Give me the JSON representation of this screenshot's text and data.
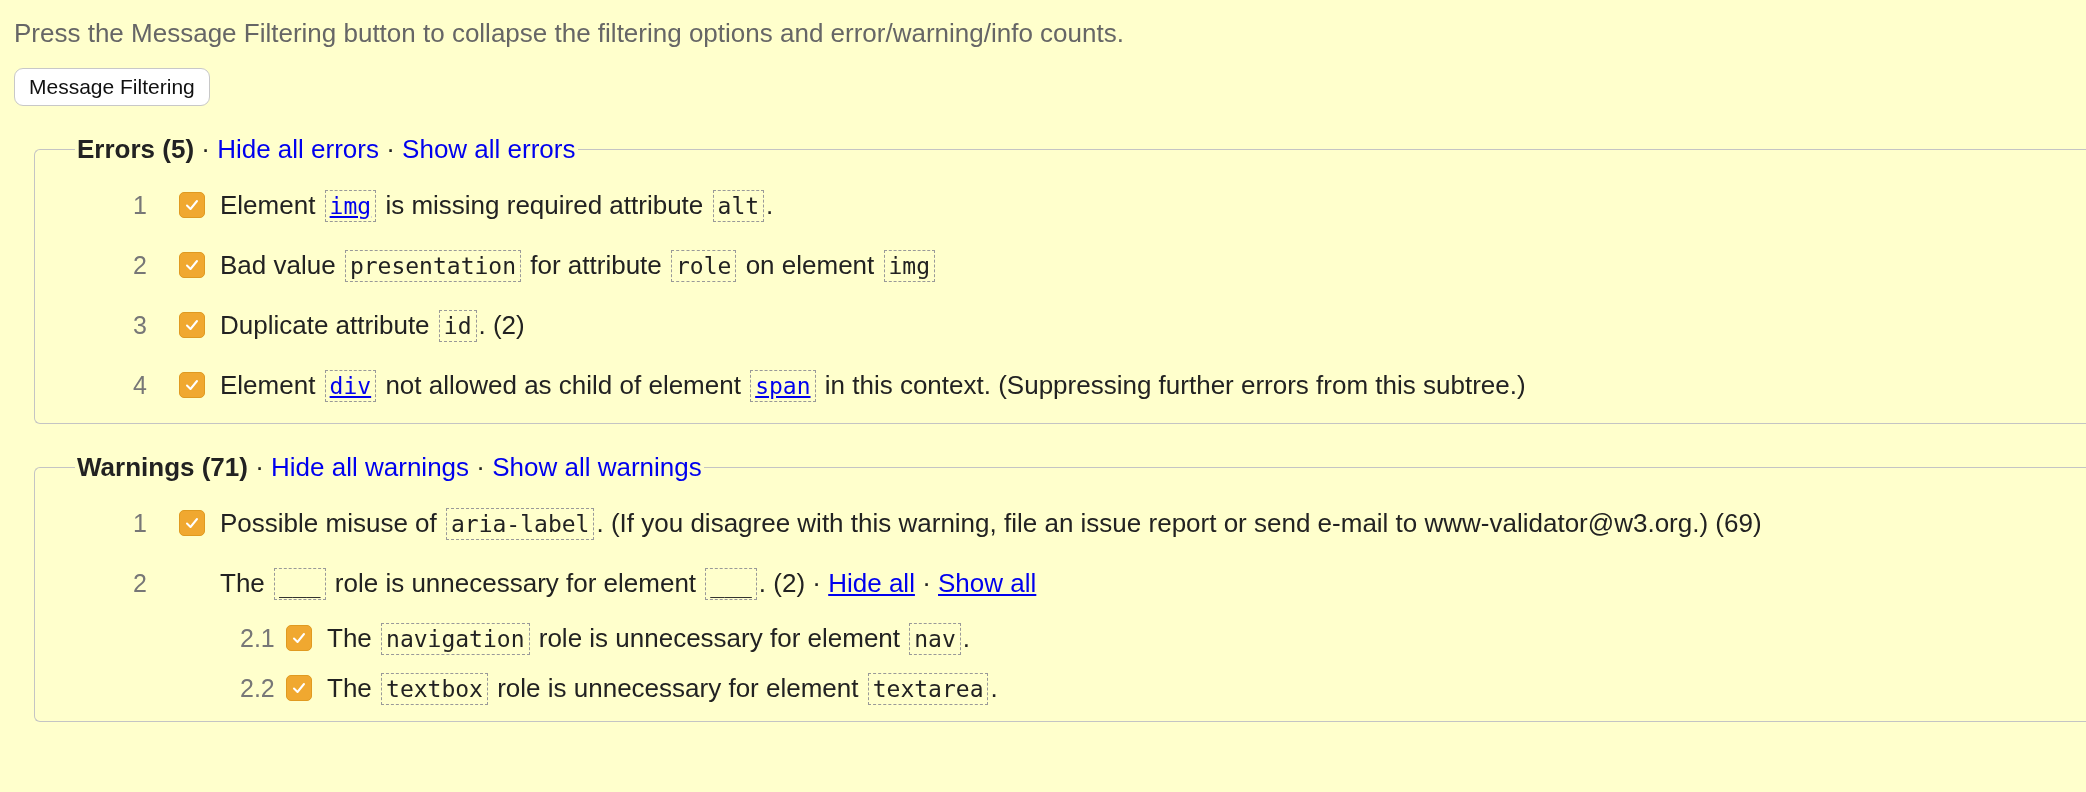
{
  "intro": "Press the Message Filtering button to collapse the filtering options and error/warning/info counts.",
  "filter_button": "Message Filtering",
  "sections": [
    {
      "title": "Errors (5)",
      "separator": "·",
      "hide_link": "Hide all errors",
      "show_link": "Show all errors",
      "items": [
        {
          "kind": "message",
          "number": "1",
          "checked": true,
          "parts": [
            {
              "kind": "text",
              "text": "Element "
            },
            {
              "kind": "code",
              "text": "img",
              "link": true
            },
            {
              "kind": "text",
              "text": " is missing required attribute "
            },
            {
              "kind": "code",
              "text": "alt",
              "link": false
            },
            {
              "kind": "text",
              "text": "."
            }
          ]
        },
        {
          "kind": "message",
          "number": "2",
          "checked": true,
          "parts": [
            {
              "kind": "text",
              "text": "Bad value "
            },
            {
              "kind": "code",
              "text": "presentation",
              "link": false
            },
            {
              "kind": "text",
              "text": " for attribute "
            },
            {
              "kind": "code",
              "text": "role",
              "link": false
            },
            {
              "kind": "text",
              "text": " on element "
            },
            {
              "kind": "code",
              "text": "img",
              "link": false
            }
          ]
        },
        {
          "kind": "message",
          "number": "3",
          "checked": true,
          "parts": [
            {
              "kind": "text",
              "text": "Duplicate attribute "
            },
            {
              "kind": "code",
              "text": "id",
              "link": false
            },
            {
              "kind": "text",
              "text": ". (2)"
            }
          ]
        },
        {
          "kind": "message",
          "number": "4",
          "checked": true,
          "parts": [
            {
              "kind": "text",
              "text": "Element "
            },
            {
              "kind": "code",
              "text": "div",
              "link": true
            },
            {
              "kind": "text",
              "text": " not allowed as child of element "
            },
            {
              "kind": "code",
              "text": "span",
              "link": true
            },
            {
              "kind": "text",
              "text": " in this context. (Suppressing further errors from this subtree.)"
            }
          ]
        }
      ]
    },
    {
      "title": "Warnings (71)",
      "separator": "·",
      "hide_link": "Hide all warnings",
      "show_link": "Show all warnings",
      "items": [
        {
          "kind": "message",
          "number": "1",
          "checked": true,
          "parts": [
            {
              "kind": "text",
              "text": "Possible misuse of "
            },
            {
              "kind": "code",
              "text": "aria-label",
              "link": false
            },
            {
              "kind": "text",
              "text": ". (If you disagree with this warning, file an issue report or send e-mail to www-validator@w3.org.) (69)"
            }
          ]
        },
        {
          "kind": "group",
          "number": "2",
          "parts": [
            {
              "kind": "text",
              "text": "The "
            },
            {
              "kind": "code",
              "text": "___",
              "link": false
            },
            {
              "kind": "text",
              "text": " role is unnecessary for element "
            },
            {
              "kind": "code",
              "text": "___",
              "link": false
            },
            {
              "kind": "text",
              "text": ". (2) · "
            },
            {
              "kind": "link",
              "text": "Hide all"
            },
            {
              "kind": "text",
              "text": " · "
            },
            {
              "kind": "link",
              "text": "Show all"
            }
          ],
          "children": [
            {
              "kind": "message",
              "number": "2.1",
              "checked": true,
              "parts": [
                {
                  "kind": "text",
                  "text": "The "
                },
                {
                  "kind": "code",
                  "text": "navigation",
                  "link": false
                },
                {
                  "kind": "text",
                  "text": " role is unnecessary for element "
                },
                {
                  "kind": "code",
                  "text": "nav",
                  "link": false
                },
                {
                  "kind": "text",
                  "text": "."
                }
              ]
            },
            {
              "kind": "message",
              "number": "2.2",
              "checked": true,
              "parts": [
                {
                  "kind": "text",
                  "text": "The "
                },
                {
                  "kind": "code",
                  "text": "textbox",
                  "link": false
                },
                {
                  "kind": "text",
                  "text": " role is unnecessary for element "
                },
                {
                  "kind": "code",
                  "text": "textarea",
                  "link": false
                },
                {
                  "kind": "text",
                  "text": "."
                }
              ]
            }
          ]
        }
      ]
    }
  ]
}
